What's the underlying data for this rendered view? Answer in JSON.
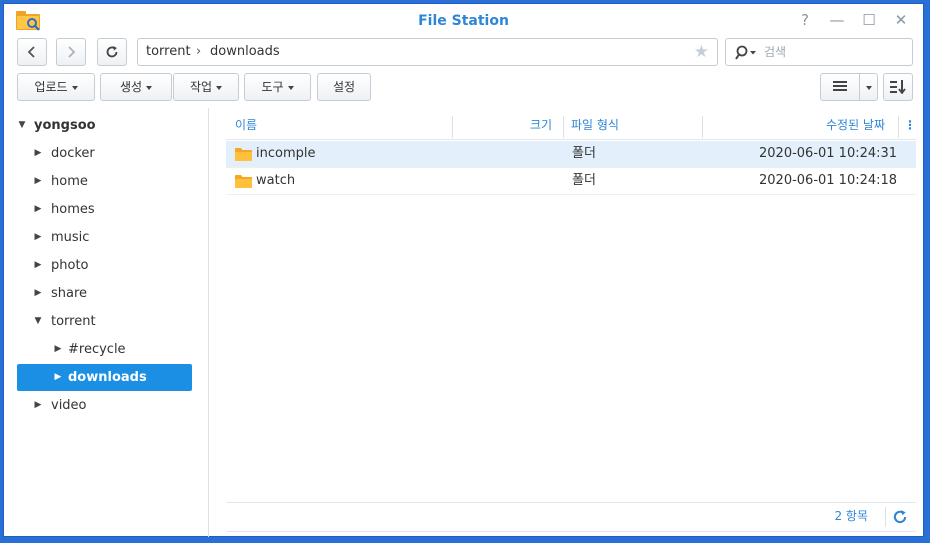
{
  "window": {
    "title": "File Station"
  },
  "title_buttons": {
    "help": "?",
    "minimize": "—",
    "maximize": "☐",
    "close": "✕"
  },
  "path": {
    "segments": [
      "torrent",
      "downloads"
    ],
    "separator": "›"
  },
  "search": {
    "placeholder": "검색"
  },
  "toolbar": {
    "upload": "업로드",
    "create": "생성",
    "action": "작업",
    "tools": "도구",
    "settings": "설정"
  },
  "tree": {
    "root": "yongsoo",
    "items": [
      {
        "label": "docker",
        "expanded": false
      },
      {
        "label": "home",
        "expanded": false
      },
      {
        "label": "homes",
        "expanded": false
      },
      {
        "label": "music",
        "expanded": false
      },
      {
        "label": "photo",
        "expanded": false
      },
      {
        "label": "share",
        "expanded": false
      },
      {
        "label": "torrent",
        "expanded": true
      },
      {
        "label": "#recycle",
        "expanded": false
      },
      {
        "label": "downloads",
        "expanded": false,
        "selected": true
      },
      {
        "label": "video",
        "expanded": false
      }
    ]
  },
  "table": {
    "columns": {
      "name": "이름",
      "size": "크기",
      "type": "파일 형식",
      "modified": "수정된 날짜"
    },
    "rows": [
      {
        "name": "incomple",
        "size": "",
        "type": "폴더",
        "modified": "2020-06-01 10:24:31",
        "selected": true
      },
      {
        "name": "watch",
        "size": "",
        "type": "폴더",
        "modified": "2020-06-01 10:24:18",
        "selected": false
      }
    ]
  },
  "footer": {
    "count": "2 항목"
  },
  "colors": {
    "accent": "#2e86d6",
    "selected": "#1a8fe3",
    "row_selected": "#e3f0fb",
    "frame": "#2a6fd6",
    "folder": "#f5a623"
  }
}
